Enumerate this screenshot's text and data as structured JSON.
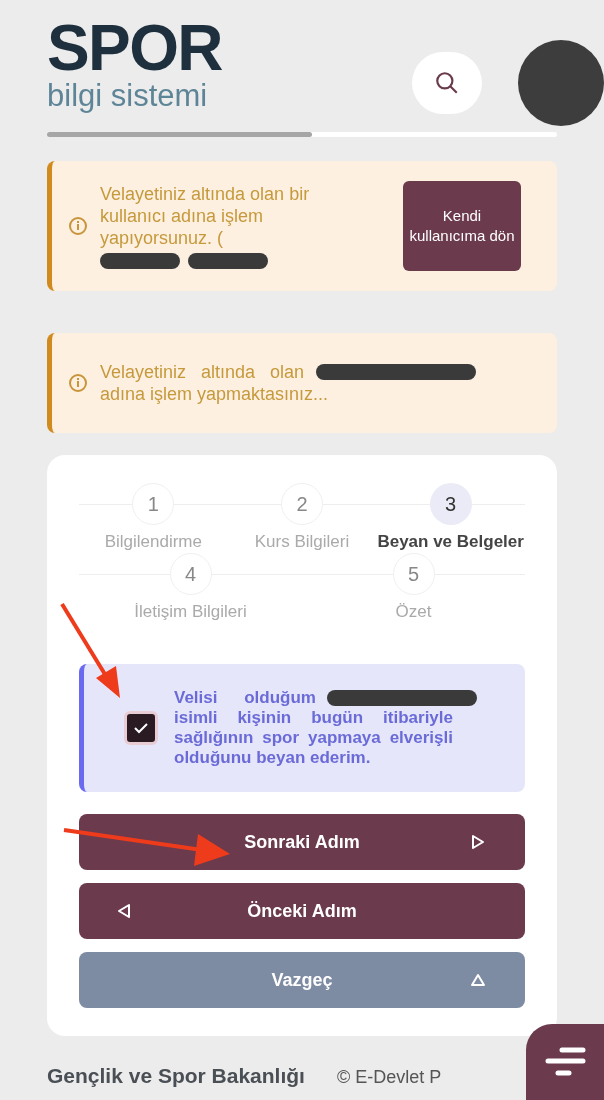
{
  "header": {
    "logo_title": "SPOR",
    "logo_subtitle": "bilgi sistemi",
    "progress": {
      "level": 0.52
    }
  },
  "alerts": [
    {
      "kind": "with_button",
      "text": "Velayetiniz altında olan bir kullanıcı adına işlem yapıyorsunuz. (",
      "button": "Kendi kullanıcıma dön"
    },
    {
      "kind": "plain",
      "text": "Velayetiniz altında olan",
      "text_2": "adına işlem yapmaktasınız..."
    }
  ],
  "steps": [
    {
      "number": "1",
      "label": "Bilgilendirme",
      "selected": false
    },
    {
      "number": "2",
      "label": "Kurs Bilgileri",
      "selected": false
    },
    {
      "number": "3",
      "label": "Beyan ve Belgeler",
      "selected": true
    },
    {
      "number": "4",
      "label": "İletişim Bilgileri",
      "selected": false
    },
    {
      "number": "5",
      "label": "Özet",
      "selected": false
    }
  ],
  "declaration": {
    "checked": true,
    "text_start": "Velisi olduğum",
    "text_rest": "isimli kişinin bugün itibariyle sağlığının spor yapmaya elverişli olduğunu beyan ederim."
  },
  "buttons": [
    {
      "kind": "next",
      "label": "Sonraki Adım"
    },
    {
      "kind": "previous",
      "label": "Önceki Adım"
    },
    {
      "kind": "cancel",
      "label": "Vazgeç"
    }
  ],
  "footer": {
    "ministry": "Gençlik ve Spor Bakanlığı",
    "copyright": "© E-Devlet P"
  }
}
